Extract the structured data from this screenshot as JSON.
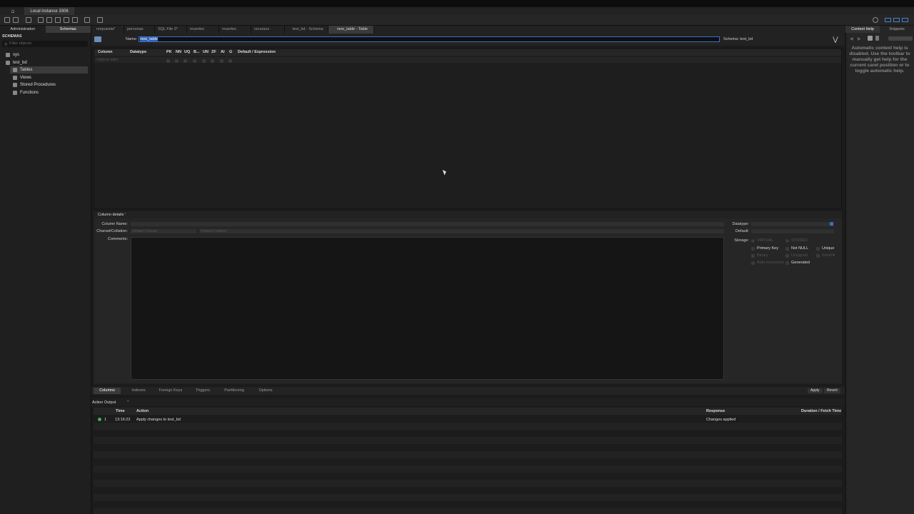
{
  "window": {
    "instance_tab": "Local instance 3306"
  },
  "sidebar": {
    "tabs": [
      {
        "label": "Administration"
      },
      {
        "label": "Schemas"
      }
    ],
    "section_title": "SCHEMAS",
    "filter_placeholder": "Filter objects",
    "tree": [
      {
        "label": "sys"
      },
      {
        "label": "test_bd"
      },
      {
        "label": "Tables"
      },
      {
        "label": "Views"
      },
      {
        "label": "Stored Procedures"
      },
      {
        "label": "Functions"
      }
    ]
  },
  "editor_tabs": [
    {
      "label": "respuesta*"
    },
    {
      "label": "personas"
    },
    {
      "label": "SQL File 3*"
    },
    {
      "label": "muertes"
    },
    {
      "label": "muertes"
    },
    {
      "label": "recursos"
    },
    {
      "label": "test_bd - Schema"
    },
    {
      "label": "new_table - Table"
    }
  ],
  "table_editor": {
    "name_label": "Name:",
    "name_value": "new_table",
    "schema_label": "Schema:",
    "schema_value": "test_bd",
    "grid_headers": {
      "column": "Column",
      "datatype": "Datatype",
      "pk": "PK",
      "nn": "NN",
      "uq": "UQ",
      "b": "B...",
      "un": "UN",
      "zf": "ZF",
      "ai": "AI",
      "g": "G",
      "default": "Default / Expression"
    },
    "grid_placeholder": "<click to edit>"
  },
  "column_details": {
    "title": "Column details '",
    "column_name_label": "Column Name:",
    "charset_label": "Charset/Collation:",
    "charset_value": "Default Charset",
    "collation_value": "Default Collation",
    "comments_label": "Comments:",
    "datatype_label": "Datatype:",
    "default_label": "Default:",
    "storage_label": "Storage:",
    "storage_options": {
      "virtual": "VIRTUAL",
      "stored": "STORED",
      "primary_key": "Primary Key",
      "not_null": "Not NULL",
      "unique": "Unique",
      "binary": "Binary",
      "unsigned": "Unsigned",
      "zerofill": "ZeroFill",
      "auto_increment": "Auto Increment",
      "generated": "Generated"
    }
  },
  "bottom_tabs": [
    {
      "label": "Columns"
    },
    {
      "label": "Indexes"
    },
    {
      "label": "Foreign Keys"
    },
    {
      "label": "Triggers"
    },
    {
      "label": "Partitioning"
    },
    {
      "label": "Options"
    }
  ],
  "actions": {
    "apply": "Apply",
    "revert": "Revert"
  },
  "action_output": {
    "title": "Action Output",
    "caret": "⌃",
    "headers": {
      "time": "Time",
      "action": "Action",
      "response": "Response",
      "duration": "Duration / Fetch Time"
    },
    "rows": [
      {
        "num": "1",
        "time": "13:16:22",
        "action": "Apply changes to test_bd",
        "response": "Changes applied"
      }
    ]
  },
  "right_panel": {
    "tabs": [
      {
        "label": "Context Help"
      },
      {
        "label": "Snippets"
      }
    ],
    "help_text": "Automatic context help is disabled. Use the toolbar to manually get help for the current caret position or to toggle automatic help."
  },
  "colors": {
    "accent": "#3d6fc4",
    "status_ok": "#3cb44a"
  }
}
